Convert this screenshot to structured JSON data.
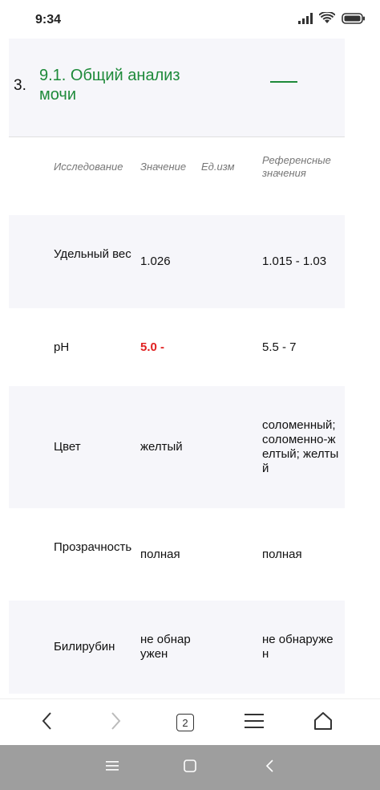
{
  "status_bar": {
    "time": "9:34",
    "icons": [
      "signal-icon",
      "wifi-icon",
      "battery-icon"
    ]
  },
  "section": {
    "number": "3.",
    "title": "9.1. Общий анализ мочи",
    "status_dash": "—",
    "accent_color": "#1e8a3a"
  },
  "table": {
    "headers": {
      "name": "Исследование",
      "value": "Значение",
      "unit": "Ед.изм",
      "reference": "Референсные значения"
    },
    "rows": [
      {
        "name": "Удельный вес",
        "value": "1.026",
        "unit": "",
        "reference": "1.015 - 1.03",
        "abnormal": false
      },
      {
        "name": "pH",
        "value": "5.0 -",
        "unit": "",
        "reference": "5.5 - 7",
        "abnormal": true
      },
      {
        "name": "Цвет",
        "value": "желтый",
        "unit": "",
        "reference": "соломенный; соломенно-желтый; желтый",
        "abnormal": false
      },
      {
        "name": "Прозрачность",
        "value": "полная",
        "unit": "",
        "reference": "полная",
        "abnormal": false
      },
      {
        "name": "Билирубин",
        "value": "не обнаружен",
        "unit": "",
        "reference": "не обнаружен",
        "abnormal": false
      }
    ],
    "abnormal_color": "#e02020"
  },
  "browser_nav": {
    "back": "chevron-left-icon",
    "forward": "chevron-right-icon",
    "tabs_count": "2",
    "menu": "menu-icon",
    "home": "home-icon"
  },
  "system_nav": {
    "recents": "recents-icon",
    "home": "square-home-icon",
    "back": "back-icon"
  }
}
